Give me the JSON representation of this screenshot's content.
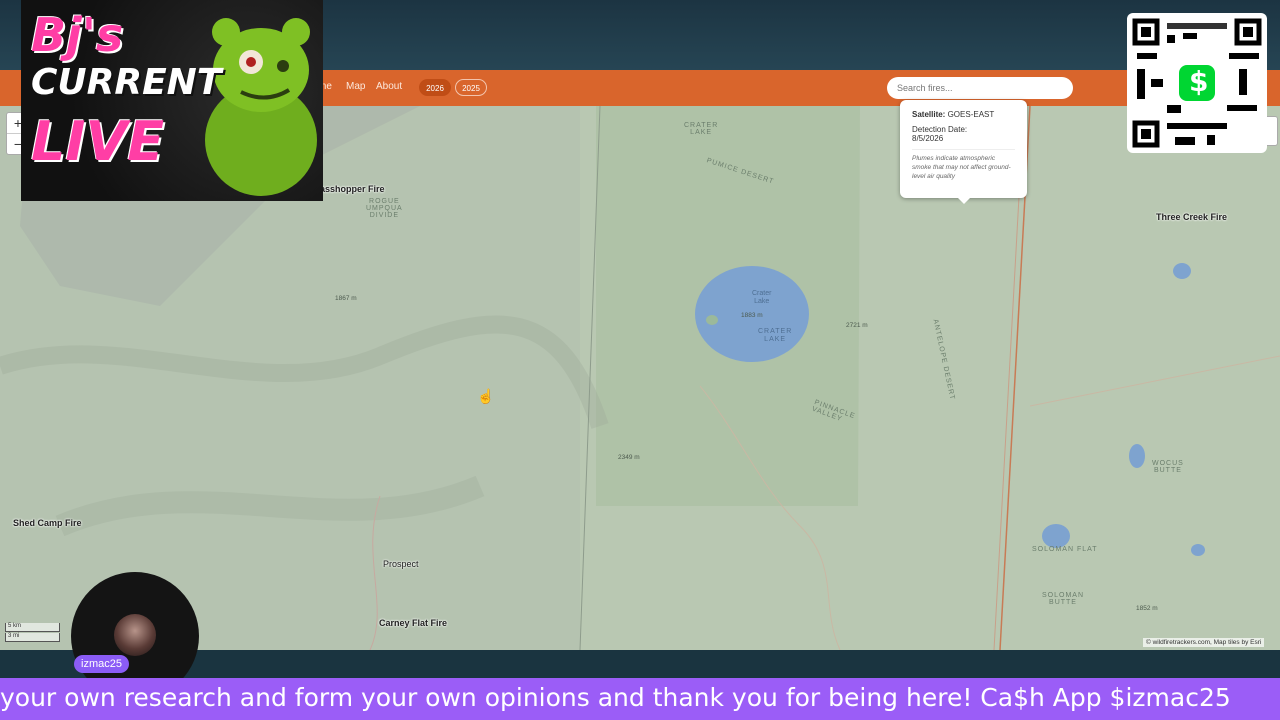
{
  "nav": {
    "links": [
      "me",
      "Map",
      "About"
    ],
    "years": [
      "2026",
      "2025"
    ],
    "active_year": "2026"
  },
  "search": {
    "placeholder": "Search fires..."
  },
  "map": {
    "zoom_in": "+",
    "zoom_out": "−",
    "fires": {
      "grasshopper": "asshopper Fire",
      "three_creek": "Three Creek Fire",
      "shed_camp": "Shed Camp Fire",
      "carney_flat": "Carney Flat Fire"
    },
    "places": {
      "prospect": "Prospect",
      "crater_lake_top": "CRATER\nLAKE",
      "pumice_desert": "PUMICE DESERT",
      "pinnacle_valley": "PINNACLE\nVALLEY",
      "antelope_desert": "ANTELOPE DESERT",
      "solomon_flat": "SOLOMAN FLAT",
      "solomon_butte": "SOLOMAN\nBUTTE",
      "wocus_butte": "WOCUS\nBUTTE",
      "rogue_umpqua": "ROGUE\nUMPQUA\nDIVIDE"
    },
    "lake": {
      "name": "Crater\nLake",
      "elev": "1883 m",
      "label": "CRATER\nLAKE"
    },
    "elevations": {
      "e1": "1867 m",
      "e2": "2721 m",
      "e3": "2349 m",
      "e4": "1852 m"
    },
    "scale_km": "5 km",
    "scale_mi": "3 mi",
    "attribution": "© wildfiretrackers.com, Map tiles by Esri"
  },
  "popup": {
    "satellite_label": "Satellite:",
    "satellite_value": "GOES-EAST",
    "date_label": "Detection Date:",
    "date_value": "8/5/2026",
    "note": "Plumes indicate atmospheric smoke that may not affect ground-level air quality"
  },
  "overlay": {
    "logo_line1": "Bj's",
    "logo_line2": "CURRENT",
    "logo_line3": "LIVE",
    "username": "izmac25",
    "ticker": "your own research and form your own opinions and thank you for being here! Ca$h App $izmac25",
    "qr_symbol": "$"
  },
  "colors": {
    "nav": "#d9652c",
    "ticker": "#9b5df7",
    "lake": "#7ea3cf",
    "cashapp": "#00d632"
  }
}
